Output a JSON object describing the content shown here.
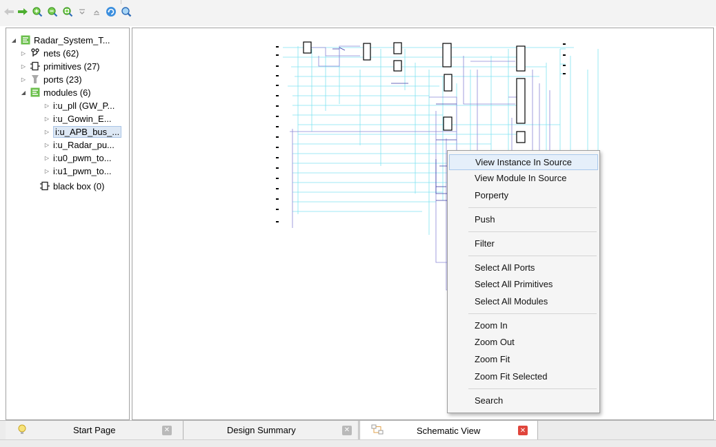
{
  "toolbar": {
    "icons": [
      "back-arrow-icon",
      "forward-arrow-icon",
      "zoom-in-icon",
      "zoom-out-icon",
      "zoom-fit-icon",
      "collapse-icon",
      "expand-icon",
      "refresh-icon",
      "search-icon"
    ]
  },
  "tree": {
    "root": "Radar_System_T...",
    "nets": "nets (62)",
    "primitives": "primitives (27)",
    "ports": "ports (23)",
    "modules": "modules (6)",
    "module_items": [
      "i:u_pll (GW_P...",
      "i:u_Gowin_E...",
      "i:u_APB_bus_...",
      "i:u_Radar_pu...",
      "i:u0_pwm_to...",
      "i:u1_pwm_to..."
    ],
    "black_box": "black box (0)"
  },
  "context_menu": {
    "view_instance": "View Instance In Source",
    "view_module": "View Module In Source",
    "property": "Porperty",
    "push": "Push",
    "filter": "Filter",
    "select_ports": "Select All Ports",
    "select_primitives": "Select All Primitives",
    "select_modules": "Select All Modules",
    "zoom_in": "Zoom In",
    "zoom_out": "Zoom Out",
    "zoom_fit": "Zoom Fit",
    "zoom_fit_selected": "Zoom Fit Selected",
    "search": "Search"
  },
  "tabs": {
    "start_page": "Start Page",
    "design_summary": "Design Summary",
    "schematic_view": "Schematic View"
  },
  "colors": {
    "wire_cyan": "#7fe3f0",
    "wire_violet": "#8a86d6",
    "wire_blue": "#3a3aa8",
    "menu_highlight": "#e5effa",
    "close_active": "#e0453c"
  }
}
